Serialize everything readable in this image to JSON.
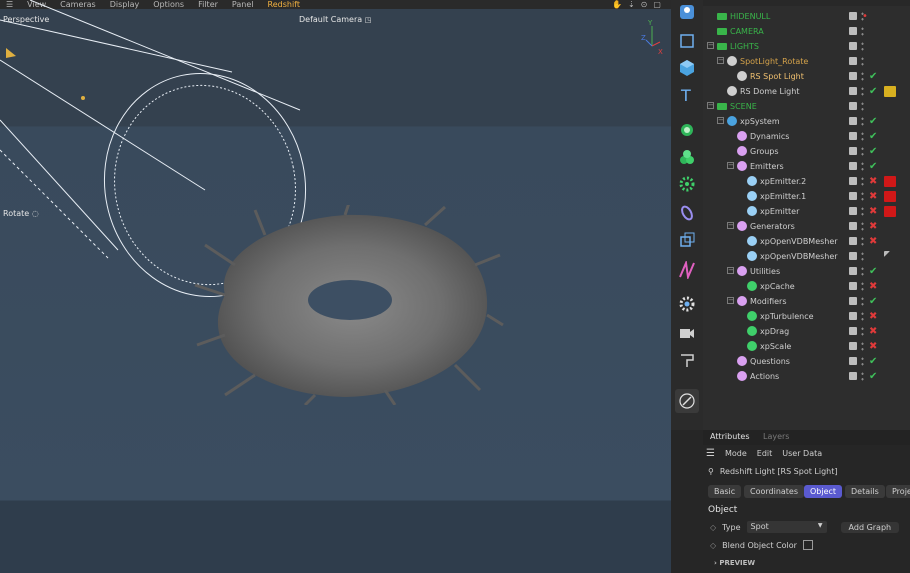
{
  "viewport": {
    "menu": [
      "View",
      "Cameras",
      "Display",
      "Options",
      "Filter",
      "Panel",
      "Redshift"
    ],
    "menu_highlight": "Redshift",
    "view_name": "Perspective",
    "camera_name": "Default Camera",
    "mode_label": "Rotate"
  },
  "objects": [
    {
      "label": "HIDENULL",
      "indent": 0,
      "expand": "",
      "icon": "null-icon",
      "color": "#39b54a",
      "status": "red-dot",
      "tag": ""
    },
    {
      "label": "CAMERA",
      "indent": 0,
      "expand": "",
      "icon": "null-icon",
      "color": "#39b54a",
      "status": "",
      "tag": ""
    },
    {
      "label": "LIGHTS",
      "indent": 0,
      "expand": "-",
      "icon": "null-icon",
      "color": "#39b54a",
      "status": "",
      "tag": ""
    },
    {
      "label": "SpotLight_Rotate",
      "indent": 1,
      "expand": "-",
      "icon": "spotlight-icon",
      "color": "#d4a24a",
      "status": "",
      "tag": ""
    },
    {
      "label": "RS Spot Light",
      "indent": 2,
      "expand": "",
      "icon": "rs-spot-icon",
      "color": "#f0c070",
      "status": "check",
      "tag": ""
    },
    {
      "label": "RS Dome Light",
      "indent": 1,
      "expand": "",
      "icon": "dome-icon",
      "color": "#cfcfcf",
      "status": "check",
      "tag": "yellow"
    },
    {
      "label": "SCENE",
      "indent": 0,
      "expand": "-",
      "icon": "null-icon",
      "color": "#39b54a",
      "status": "",
      "tag": ""
    },
    {
      "label": "xpSystem",
      "indent": 1,
      "expand": "-",
      "icon": "xp-system-icon",
      "color": "#cfcfcf",
      "status": "check",
      "tag": ""
    },
    {
      "label": "Dynamics",
      "indent": 2,
      "expand": "",
      "icon": "xp-folder-icon",
      "color": "#cfcfcf",
      "status": "check",
      "tag": ""
    },
    {
      "label": "Groups",
      "indent": 2,
      "expand": "",
      "icon": "xp-folder-icon",
      "color": "#cfcfcf",
      "status": "check",
      "tag": ""
    },
    {
      "label": "Emitters",
      "indent": 2,
      "expand": "-",
      "icon": "xp-folder-icon",
      "color": "#cfcfcf",
      "status": "check",
      "tag": ""
    },
    {
      "label": "xpEmitter.2",
      "indent": 3,
      "expand": "",
      "icon": "emitter-icon",
      "color": "#cfcfcf",
      "status": "cross",
      "tag": "red"
    },
    {
      "label": "xpEmitter.1",
      "indent": 3,
      "expand": "",
      "icon": "emitter-icon",
      "color": "#cfcfcf",
      "status": "cross",
      "tag": "red"
    },
    {
      "label": "xpEmitter",
      "indent": 3,
      "expand": "",
      "icon": "emitter-icon",
      "color": "#cfcfcf",
      "status": "cross",
      "tag": "red"
    },
    {
      "label": "Generators",
      "indent": 2,
      "expand": "-",
      "icon": "xp-folder-icon",
      "color": "#cfcfcf",
      "status": "cross",
      "tag": ""
    },
    {
      "label": "xpOpenVDBMesher",
      "indent": 3,
      "expand": "",
      "icon": "mesher-icon",
      "color": "#cfcfcf",
      "status": "cross",
      "tag": ""
    },
    {
      "label": "xpOpenVDBMesher",
      "indent": 3,
      "expand": "",
      "icon": "mesher-icon",
      "color": "#cfcfcf",
      "status": "",
      "tag": "marker"
    },
    {
      "label": "Utilities",
      "indent": 2,
      "expand": "-",
      "icon": "xp-folder-icon",
      "color": "#cfcfcf",
      "status": "check",
      "tag": ""
    },
    {
      "label": "xpCache",
      "indent": 3,
      "expand": "",
      "icon": "cache-icon",
      "color": "#cfcfcf",
      "status": "cross",
      "tag": ""
    },
    {
      "label": "Modifiers",
      "indent": 2,
      "expand": "-",
      "icon": "xp-folder-icon",
      "color": "#cfcfcf",
      "status": "check",
      "tag": ""
    },
    {
      "label": "xpTurbulence",
      "indent": 3,
      "expand": "",
      "icon": "modifier-icon",
      "color": "#cfcfcf",
      "status": "cross",
      "tag": ""
    },
    {
      "label": "xpDrag",
      "indent": 3,
      "expand": "",
      "icon": "modifier-icon",
      "color": "#cfcfcf",
      "status": "cross",
      "tag": ""
    },
    {
      "label": "xpScale",
      "indent": 3,
      "expand": "",
      "icon": "modifier-icon",
      "color": "#cfcfcf",
      "status": "cross",
      "tag": ""
    },
    {
      "label": "Questions",
      "indent": 2,
      "expand": "",
      "icon": "xp-folder-icon",
      "color": "#cfcfcf",
      "status": "check",
      "tag": ""
    },
    {
      "label": "Actions",
      "indent": 2,
      "expand": "",
      "icon": "xp-folder-icon",
      "color": "#cfcfcf",
      "status": "check",
      "tag": ""
    }
  ],
  "attributes": {
    "tabs": [
      "Attributes",
      "Layers"
    ],
    "menu": [
      "Mode",
      "Edit",
      "User Data"
    ],
    "object_title": "Redshift Light [RS Spot Light]",
    "subtabs": [
      "Basic",
      "Coordinates",
      "Object",
      "Details",
      "Proje"
    ],
    "active_subtab": "Object",
    "section": "Object",
    "type_label": "Type",
    "type_value": "Spot",
    "add_graph": "Add Graph",
    "blend_label": "Blend Object Color",
    "preview": "PREVIEW"
  },
  "colors": {
    "accent": "#5a5ad0",
    "check": "#3fbf5a",
    "cross": "#e03a3a",
    "highlight": "#f0b040"
  }
}
